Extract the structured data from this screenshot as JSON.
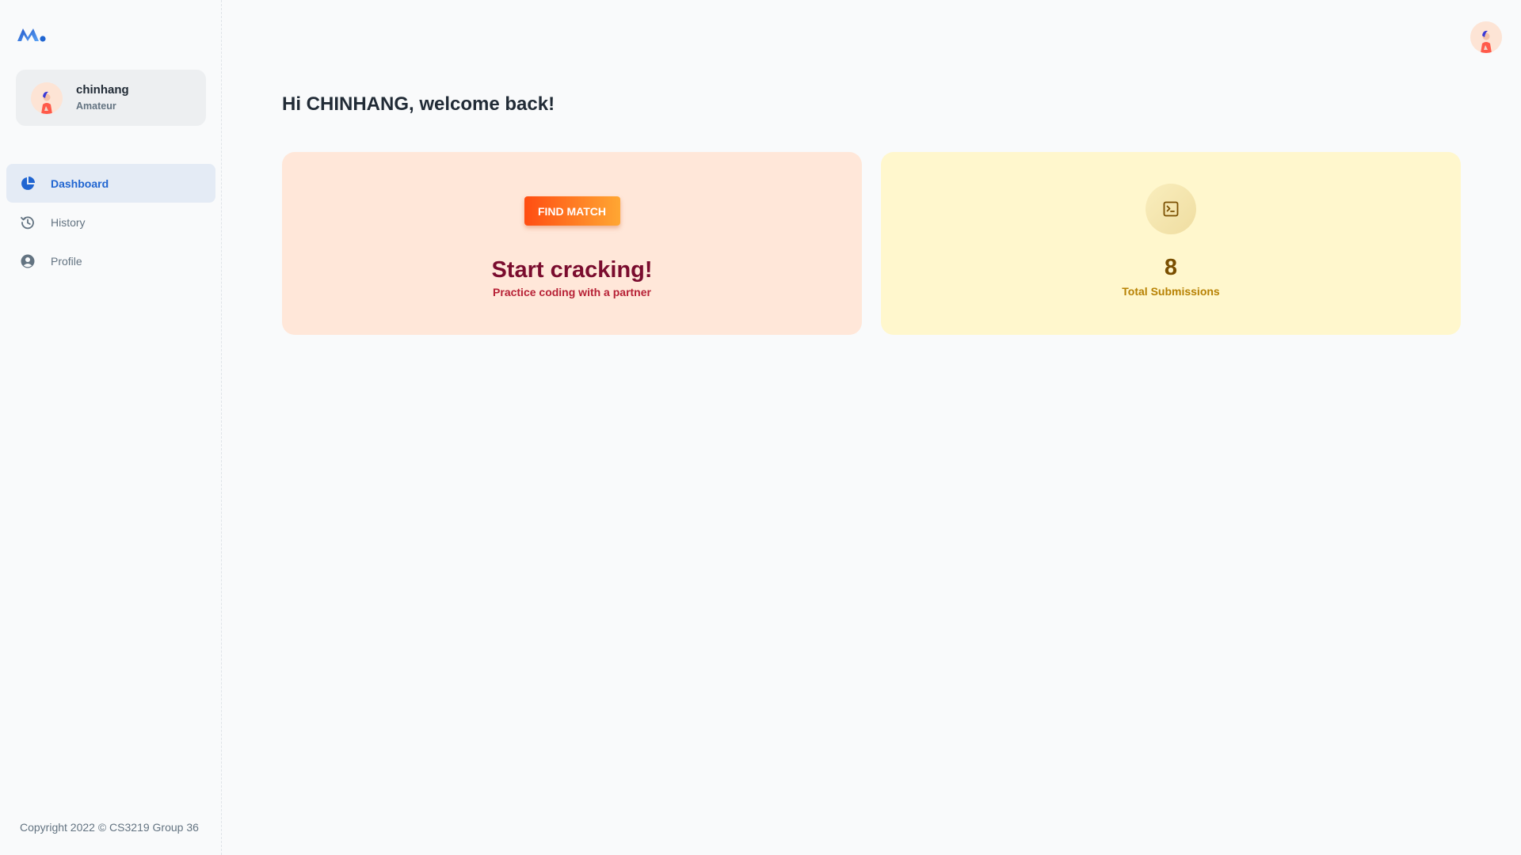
{
  "account": {
    "name": "chinhang",
    "role": "Amateur"
  },
  "nav": {
    "items": [
      {
        "label": "Dashboard",
        "icon": "pie-chart-icon",
        "active": true
      },
      {
        "label": "History",
        "icon": "history-icon",
        "active": false
      },
      {
        "label": "Profile",
        "icon": "person-icon",
        "active": false
      }
    ]
  },
  "footer": {
    "copyright": "Copyright 2022 © CS3219 Group 36"
  },
  "main": {
    "greeting": "Hi CHINHANG, welcome back!",
    "match_card": {
      "button_label": "FIND MATCH",
      "title": "Start cracking!",
      "subtitle": "Practice coding with a partner"
    },
    "submissions_card": {
      "icon": "terminal-icon",
      "count": "8",
      "label": "Total Submissions"
    }
  },
  "colors": {
    "primary": "#2065d1",
    "match_bg": "#ffe7d9",
    "submissions_bg": "#fff7cd"
  }
}
